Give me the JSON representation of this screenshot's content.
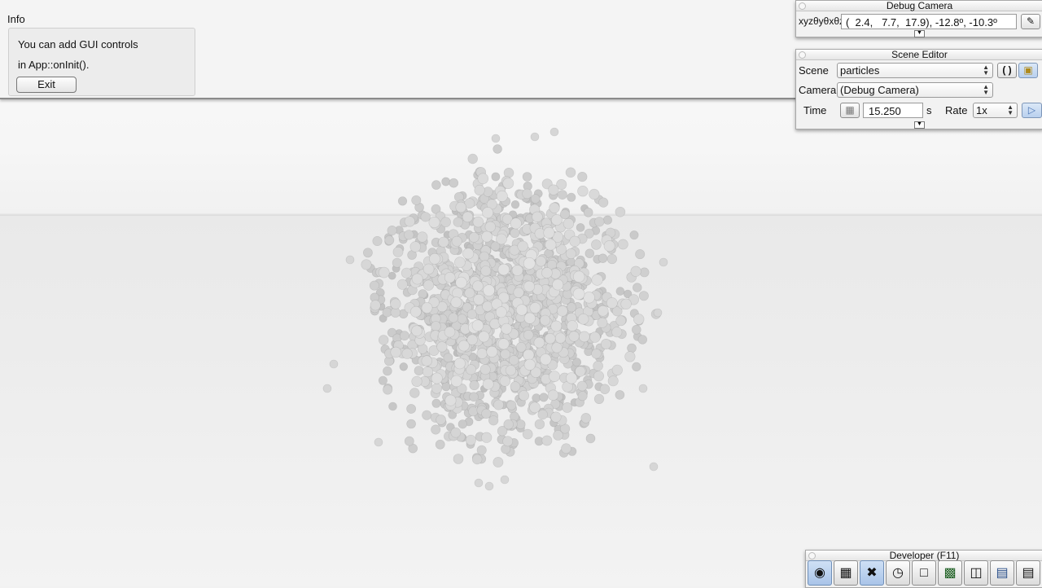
{
  "info": {
    "title": "Info",
    "line1": "You can add GUI controls",
    "line2": "in App::onInit().",
    "exit_label": "Exit"
  },
  "debug_camera": {
    "title": "Debug Camera",
    "coords_label": "xyzθyθxθz",
    "coords_value": "(  2.4,   7.7,  17.9), -12.8º, -10.3º"
  },
  "scene_editor": {
    "title": "Scene Editor",
    "scene_label": "Scene",
    "scene_value": "particles",
    "camera_label": "Camera",
    "camera_value": "(Debug Camera)",
    "time_label": "Time",
    "time_value": "15.250",
    "time_unit": "s",
    "rate_label": "Rate",
    "rate_value": "1x"
  },
  "developer": {
    "title": "Developer (F11)",
    "buttons": [
      "camera-icon",
      "clapperboard-icon",
      "tools-icon",
      "clock-icon",
      "window-icon",
      "console-icon",
      "stats-icon",
      "profiler-icon",
      "document-icon"
    ]
  },
  "colors": {
    "particle": "#c8c8c8",
    "active_button": "#b9d0ee"
  }
}
